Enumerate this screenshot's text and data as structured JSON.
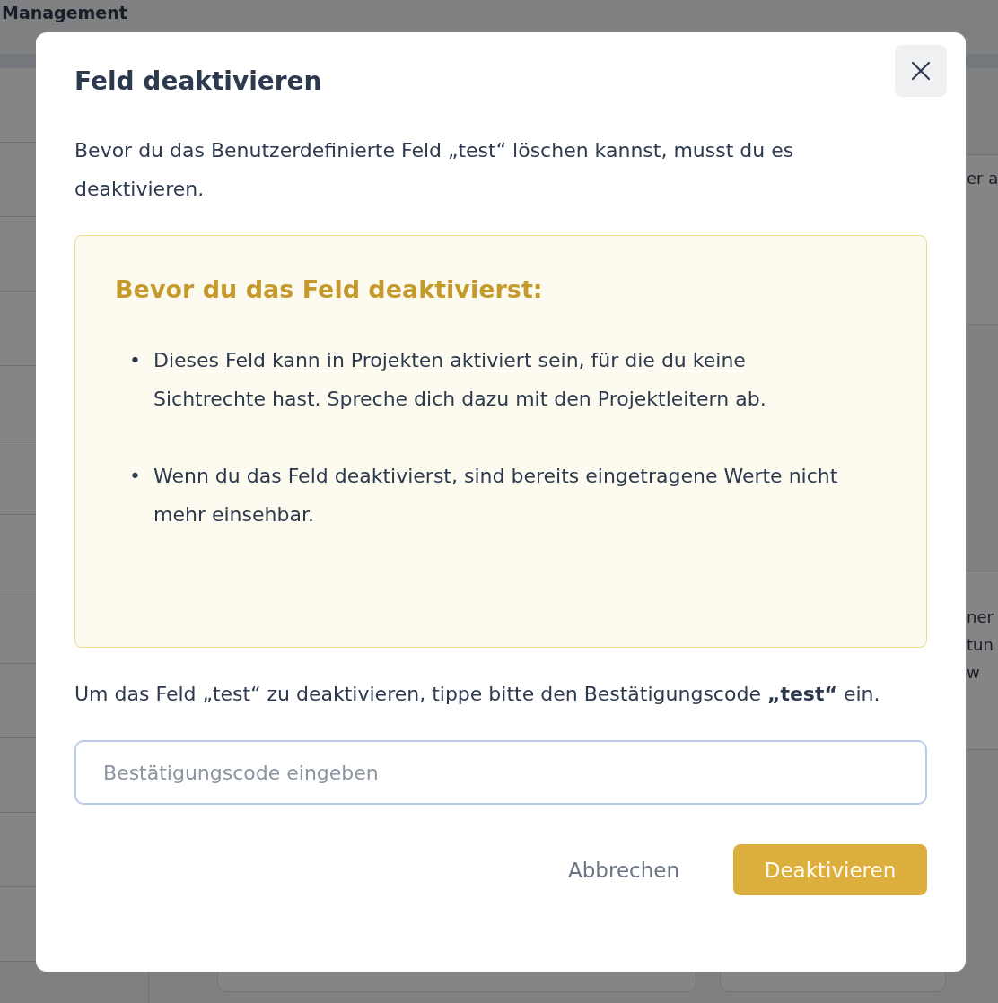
{
  "background": {
    "page_title": "Management",
    "fragments": [
      {
        "text": "er a"
      },
      {
        "text": "ner"
      },
      {
        "text": "tun"
      },
      {
        "text": "w"
      }
    ]
  },
  "dialog": {
    "title": "Feld deaktivieren",
    "intro": "Bevor du das Benutzerdefinierte Feld „test“ löschen kannst, musst du es deaktivieren.",
    "warning": {
      "title": "Bevor du das Feld deaktivierst:",
      "items": [
        {
          "bullet": "•",
          "text": "Dieses Feld kann in Projekten aktiviert sein, für die du keine Sichtrechte hast. Spreche dich dazu mit den Projektleitern ab."
        },
        {
          "bullet": "•",
          "text": "Wenn du das Feld deaktivierst, sind bereits eingetragene Werte nicht mehr einsehbar."
        }
      ]
    },
    "confirm_text": "Um das Feld „test“ zu deaktivieren, tippe bitte den Bestätigungscode **„test“** ein.",
    "input": {
      "placeholder": "Bestätigungscode eingeben"
    },
    "cancel_button": "Abbrechen",
    "confirm_button": {
      "label": "Deaktivieren",
      "disabled": true
    }
  }
}
